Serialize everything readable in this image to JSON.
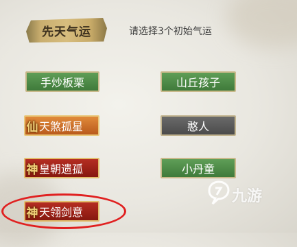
{
  "header": {
    "title": "先天气运",
    "instruction": "请选择3个初始气运"
  },
  "fortunes": [
    {
      "label": "手炒板栗",
      "rarity_color": "green",
      "badge_glyph": ""
    },
    {
      "label": "山丘孩子",
      "rarity_color": "green",
      "badge_glyph": ""
    },
    {
      "label": "天煞孤星",
      "rarity_color": "orange",
      "badge_glyph": "仙"
    },
    {
      "label": "憨人",
      "rarity_color": "grey",
      "badge_glyph": ""
    },
    {
      "label": "皇朝遗孤",
      "rarity_color": "red",
      "badge_glyph": "神"
    },
    {
      "label": "小丹童",
      "rarity_color": "green",
      "badge_glyph": ""
    },
    {
      "label": "天翎剑意",
      "rarity_color": "red",
      "badge_glyph": "神"
    }
  ],
  "colors": {
    "green": "#4f8c48",
    "grey": "#5a5a5a",
    "orange": "#d07428",
    "red": "#a02519",
    "highlight": "#e02020"
  },
  "watermark": {
    "text": "九游",
    "icon": "jiuyou-logo-icon"
  }
}
